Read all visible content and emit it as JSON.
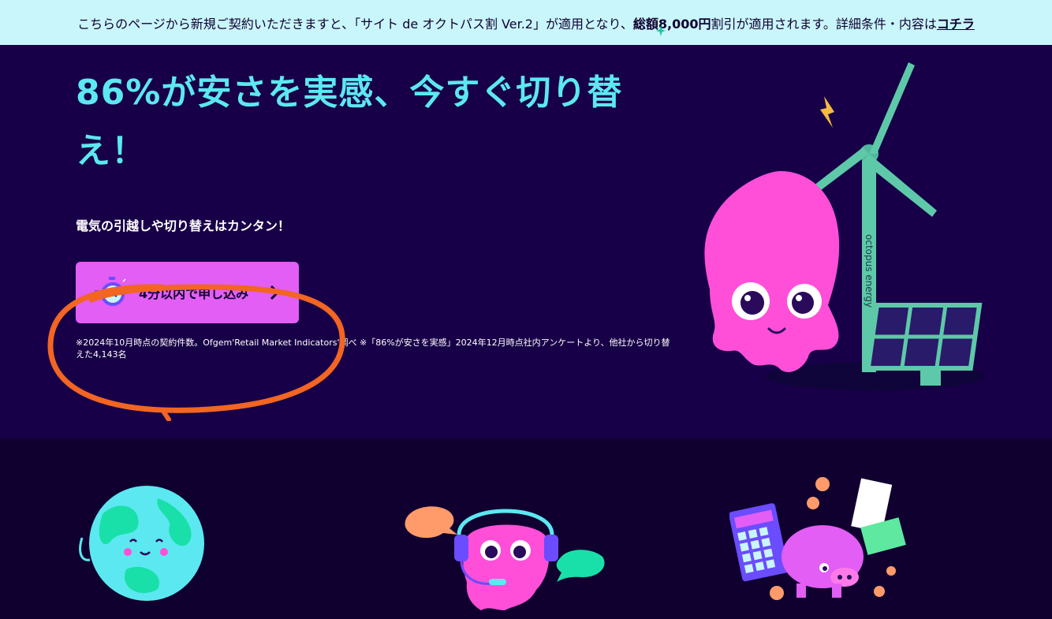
{
  "banner": {
    "text_before": "こちらのページから新規ご契約いただきますと、「サイト de オクトパス割 Ver.2」が適用となり、",
    "text_strong": "総額8,000円",
    "text_after": "割引が適用されます。詳細条件・内容は",
    "link": "コチラ"
  },
  "hero": {
    "headline": "86%が安さを実感、今すぐ切り替え！",
    "subheading": "電気の引越しや切り替えはカンタン！",
    "cta_label": "4分以内で申し込み",
    "note": "※2024年10月時点の契約件数。Ofgem'Retail Market Indicators'調べ ※「86%が安さを実感」2024年12月時点社内アンケートより、他社から切り替えた4,143名",
    "turbine_text": "octopus energy"
  },
  "colors": {
    "banner_bg": "#c9f6fb",
    "hero_bg": "#180048",
    "lower_bg": "#100030",
    "headline": "#5ce8f0",
    "cta_bg": "#e25ef5",
    "annotation": "#f26522",
    "octopus_pink": "#ff4fd8",
    "turbine_teal": "#5ec9a8"
  },
  "icons": [
    "stopwatch-icon",
    "chevron-right-icon",
    "sparkle-icon",
    "lightning-icon"
  ]
}
